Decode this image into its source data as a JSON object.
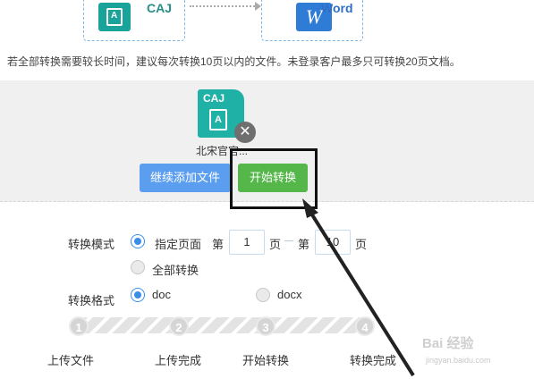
{
  "conversion": {
    "source_label": "CAJ",
    "target_label": "Word",
    "target_letter": "W"
  },
  "notice": "若全部转换需要较长时间，建议每次转换10页以内的文件。未登录客户最多只可转换20页文档。",
  "upload": {
    "file_ext": "CAJ",
    "file_name": "北宋官官...",
    "remove_glyph": "✕",
    "add_button": "继续添加文件",
    "start_button": "开始转换"
  },
  "options": {
    "mode_label": "转换模式",
    "mode_page": "指定页面",
    "page_prefix": "第",
    "page_from": "1",
    "page_mid": "页",
    "page_prefix2": "第",
    "page_to": "10",
    "page_suffix": "页",
    "mode_all": "全部转换",
    "format_label": "转换格式",
    "format_doc": "doc",
    "format_docx": "docx"
  },
  "steps": [
    {
      "num": "1",
      "label": "上传文件"
    },
    {
      "num": "2",
      "label": "上传完成"
    },
    {
      "num": "3",
      "label": "开始转换"
    },
    {
      "num": "4",
      "label": "转换完成"
    }
  ],
  "watermark": {
    "text": "Bai 经验",
    "sub": "jingyan.baidu.com"
  },
  "icons": {
    "remove": "close-icon",
    "caj": "caj-book-icon",
    "word": "word-w-icon"
  }
}
